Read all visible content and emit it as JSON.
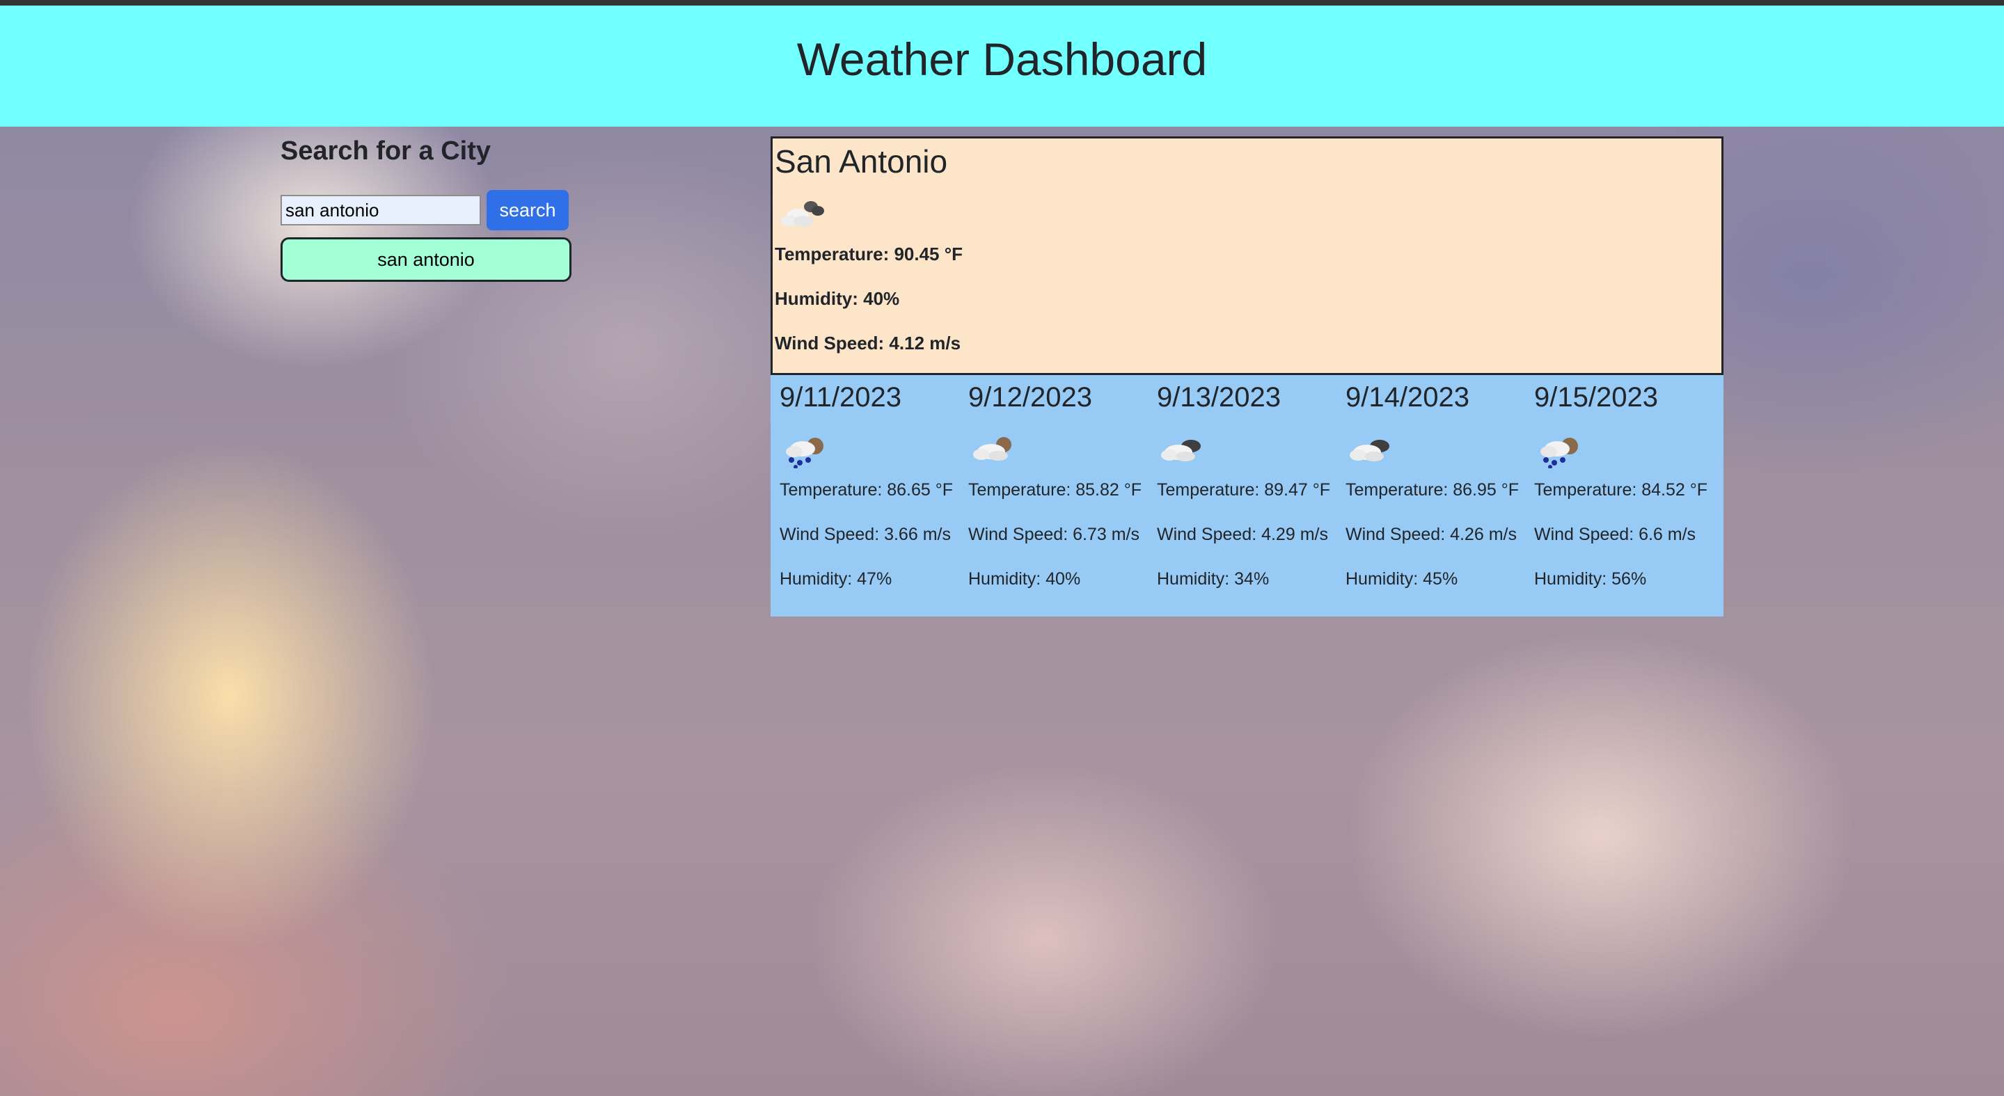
{
  "header": {
    "title": "Weather Dashboard"
  },
  "search": {
    "heading": "Search for a City",
    "input_value": "san antonio",
    "button_label": "search",
    "history": [
      "san antonio"
    ]
  },
  "current": {
    "city": "San Antonio",
    "icon": "cloud-icon",
    "temperature": "Temperature: 90.45 °F",
    "humidity": "Humidity: 40%",
    "wind": "Wind Speed: 4.12 m/s"
  },
  "forecast": [
    {
      "date": "9/11/2023",
      "icon": "rain-icon",
      "temperature": "Temperature: 86.65 °F",
      "wind": "Wind Speed: 3.66 m/s",
      "humidity": "Humidity: 47%"
    },
    {
      "date": "9/12/2023",
      "icon": "cloud-icon",
      "temperature": "Temperature: 85.82 °F",
      "wind": "Wind Speed: 6.73 m/s",
      "humidity": "Humidity: 40%"
    },
    {
      "date": "9/13/2023",
      "icon": "cloud-icon",
      "temperature": "Temperature: 89.47 °F",
      "wind": "Wind Speed: 4.29 m/s",
      "humidity": "Humidity: 34%"
    },
    {
      "date": "9/14/2023",
      "icon": "cloud-icon",
      "temperature": "Temperature: 86.95 °F",
      "wind": "Wind Speed: 4.26 m/s",
      "humidity": "Humidity: 45%"
    },
    {
      "date": "9/15/2023",
      "icon": "rain-icon",
      "temperature": "Temperature: 84.52 °F",
      "wind": "Wind Speed: 6.6 m/s",
      "humidity": "Humidity: 56%"
    }
  ],
  "colors": {
    "header_bg": "#72ffff",
    "current_bg": "#fce5c9",
    "forecast_bg": "#97cbf6",
    "search_button": "#2f6fe8",
    "history_button": "#a3ffd6"
  }
}
